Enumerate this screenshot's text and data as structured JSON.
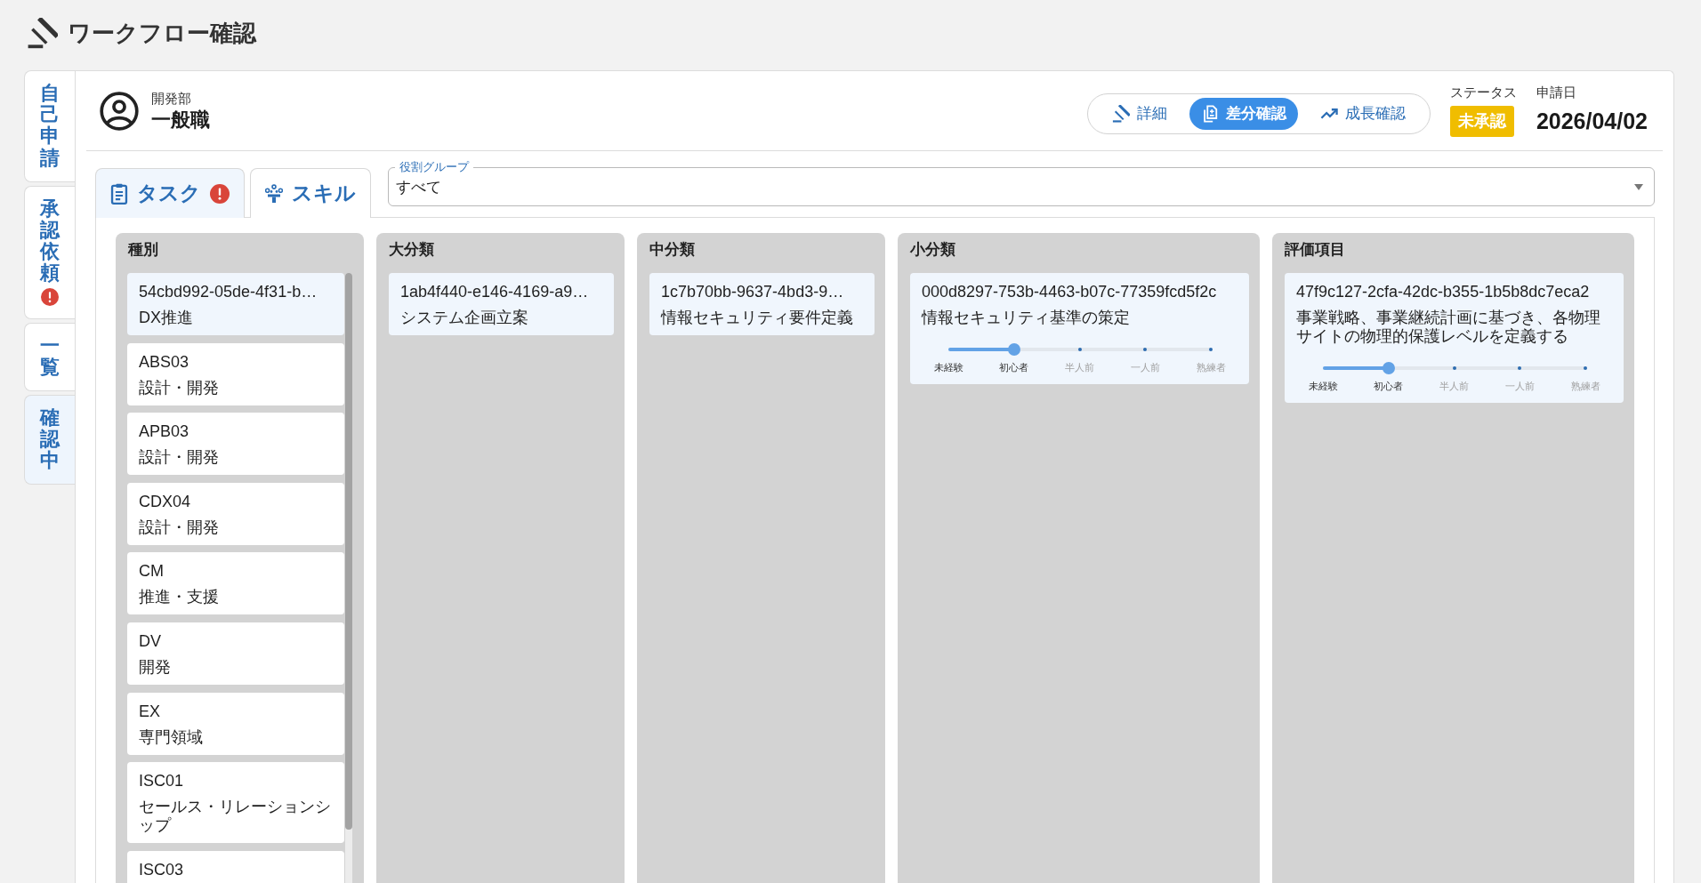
{
  "app": {
    "title": "ワークフロー確認"
  },
  "side_tabs": [
    {
      "label": "自己申請",
      "selected": false,
      "alert": false
    },
    {
      "label": "承認依頼",
      "selected": false,
      "alert": true
    },
    {
      "label": "一覧",
      "selected": false,
      "alert": false
    },
    {
      "label": "確認中",
      "selected": true,
      "alert": false
    }
  ],
  "profile": {
    "department": "開発部",
    "position": "一般職"
  },
  "view_switch": [
    {
      "label": "詳細",
      "selected": false
    },
    {
      "label": "差分確認",
      "selected": true
    },
    {
      "label": "成長確認",
      "selected": false
    }
  ],
  "status": {
    "label": "ステータス",
    "value": "未承認"
  },
  "application_date": {
    "label": "申請日",
    "value": "2026/04/02"
  },
  "tabs": [
    {
      "label": "タスク",
      "selected": true,
      "alert": true
    },
    {
      "label": "スキル",
      "selected": false,
      "alert": false
    }
  ],
  "role_group": {
    "label": "役割グループ",
    "value": "すべて"
  },
  "columns": [
    {
      "title": "種別",
      "items": [
        {
          "code": "54cbd992-05de-4f31-b…",
          "name": "DX推進",
          "selected": true
        },
        {
          "code": "ABS03",
          "name": "設計・開発",
          "selected": false
        },
        {
          "code": "APB03",
          "name": "設計・開発",
          "selected": false
        },
        {
          "code": "CDX04",
          "name": "設計・開発",
          "selected": false
        },
        {
          "code": "CM",
          "name": "推進・支援",
          "selected": false
        },
        {
          "code": "DV",
          "name": "開発",
          "selected": false
        },
        {
          "code": "EX",
          "name": "専門領域",
          "selected": false
        },
        {
          "code": "ISC01",
          "name": "セールス・リレーションシップ",
          "selected": false
        },
        {
          "code": "ISC03",
          "selected": false
        }
      ]
    },
    {
      "title": "大分類",
      "items": [
        {
          "code": "1ab4f440-e146-4169-a9…",
          "name": "システム企画立案",
          "selected": true
        }
      ]
    },
    {
      "title": "中分類",
      "items": [
        {
          "code": "1c7b70bb-9637-4bd3-9…",
          "name": "情報セキュリティ要件定義",
          "selected": true
        }
      ]
    },
    {
      "title": "小分類",
      "items": [
        {
          "code": "000d8297-753b-4463-b07c-77359fcd5f2c",
          "name": "情報セキュリティ基準の策定",
          "selected": true,
          "level": 0.25,
          "scale": [
            "未経験",
            "初心者",
            "半人前",
            "一人前",
            "熟練者"
          ]
        }
      ]
    },
    {
      "title": "評価項目",
      "items": [
        {
          "code": "47f9c127-2cfa-42dc-b355-1b5b8dc7eca2",
          "name": "事業戦略、事業継続計画に基づき、各物理サイトの物理的保護レベルを定義する",
          "selected": true,
          "level": 0.25,
          "scale": [
            "未経験",
            "初心者",
            "半人前",
            "一人前",
            "熟練者"
          ]
        }
      ]
    }
  ]
}
